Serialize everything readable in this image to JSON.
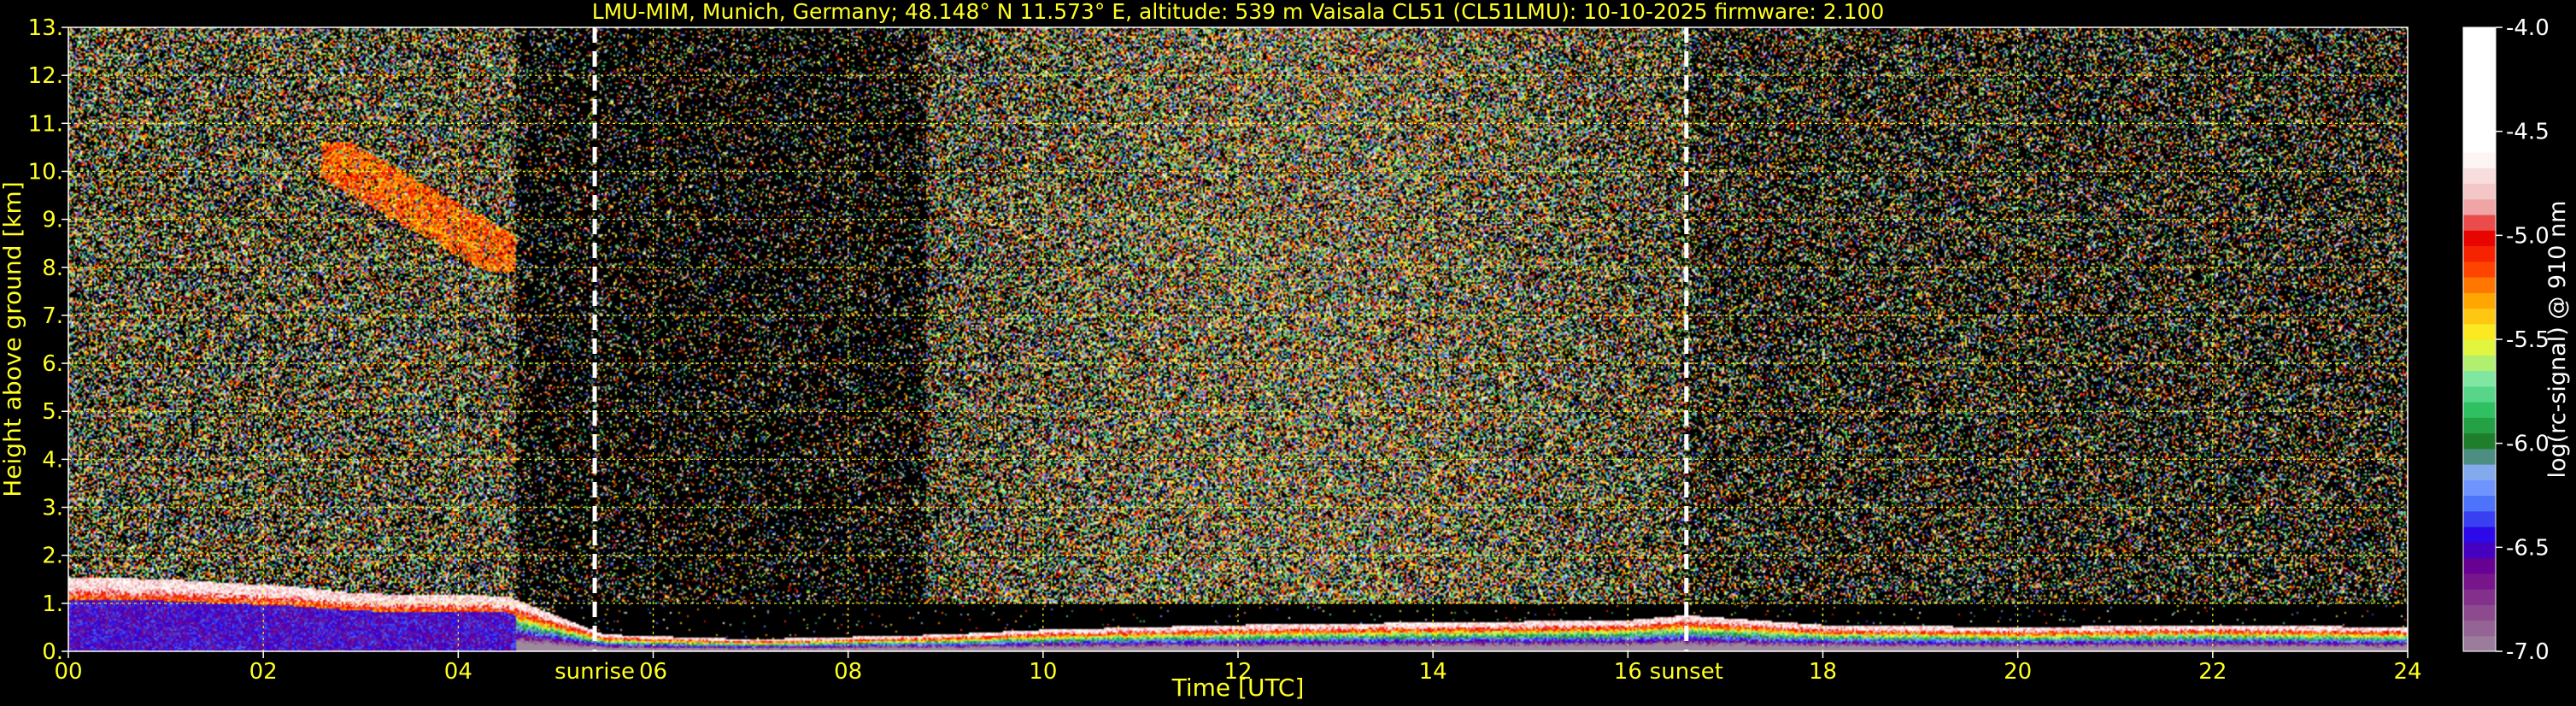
{
  "chart_data": {
    "type": "heatmap",
    "title": "LMU-MIM, Munich, Germany; 48.148° N 11.573° E, altitude: 539 m    Vaisala CL51 (CL51LMU): 10-10-2025    firmware: 2.100",
    "xlabel": "Time [UTC]",
    "ylabel": "Height above ground [km]",
    "xlim": [
      0,
      24
    ],
    "ylim": [
      0,
      13
    ],
    "x_ticks": [
      "00",
      "02",
      "04",
      "06",
      "08",
      "10",
      "12",
      "14",
      "16",
      "18",
      "20",
      "22",
      "24"
    ],
    "y_ticks": [
      "0.",
      "1.",
      "2.",
      "3.",
      "4.",
      "5.",
      "6.",
      "7.",
      "8.",
      "9.",
      "10.",
      "11.",
      "12.",
      "13."
    ],
    "grid": true,
    "markers": [
      {
        "label": "sunrise",
        "x": 5.4
      },
      {
        "label": "sunset",
        "x": 16.6
      }
    ],
    "colorbar": {
      "label": "log(rc-signal) @ 910 nm",
      "range": [
        -7.0,
        -4.0
      ],
      "ticks": [
        "-4.0",
        "-4.5",
        "-5.0",
        "-5.5",
        "-6.0",
        "-6.5",
        "-7.0"
      ]
    },
    "features": {
      "boundary_layer_top_km": [
        {
          "x": 0.0,
          "y": 1.55
        },
        {
          "x": 1.0,
          "y": 1.5
        },
        {
          "x": 2.3,
          "y": 1.35
        },
        {
          "x": 3.0,
          "y": 1.2
        },
        {
          "x": 4.5,
          "y": 1.15
        },
        {
          "x": 5.5,
          "y": 0.35
        },
        {
          "x": 7.0,
          "y": 0.25
        },
        {
          "x": 9.0,
          "y": 0.35
        },
        {
          "x": 10.0,
          "y": 0.45
        },
        {
          "x": 12.0,
          "y": 0.55
        },
        {
          "x": 14.0,
          "y": 0.6
        },
        {
          "x": 16.0,
          "y": 0.65
        },
        {
          "x": 16.6,
          "y": 0.75
        },
        {
          "x": 18.0,
          "y": 0.55
        },
        {
          "x": 20.0,
          "y": 0.5
        },
        {
          "x": 22.0,
          "y": 0.55
        },
        {
          "x": 24.0,
          "y": 0.5
        }
      ],
      "cirrus_cloud": {
        "x_range": [
          2.6,
          4.6
        ],
        "y_range": [
          7.9,
          10.6
        ]
      }
    }
  }
}
